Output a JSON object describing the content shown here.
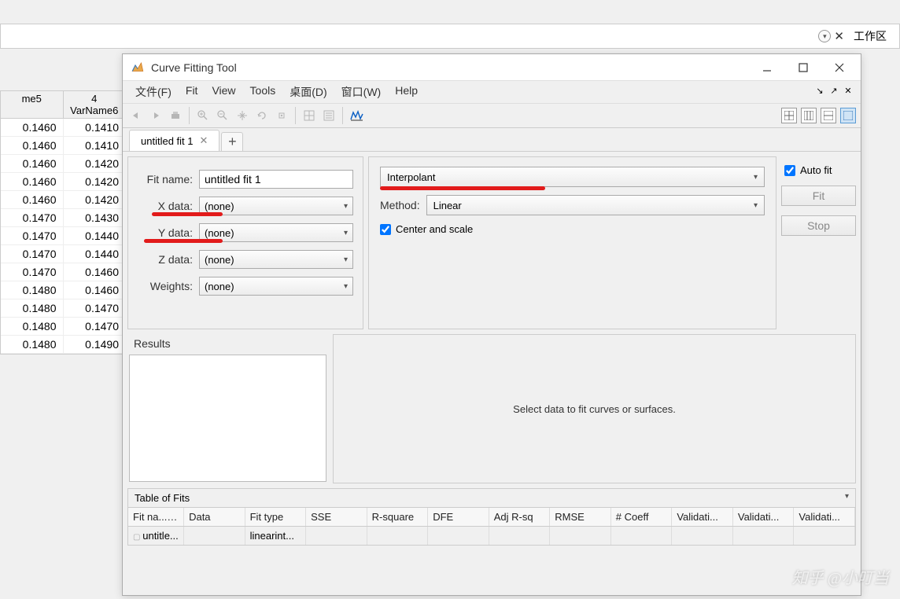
{
  "bg": {
    "workspace_label": "工作区",
    "table_headers": [
      "me5",
      "4\nVarName6"
    ],
    "col1": [
      "0.1460",
      "0.1460",
      "0.1460",
      "0.1460",
      "0.1460",
      "0.1470",
      "0.1470",
      "0.1470",
      "0.1470",
      "0.1480",
      "0.1480",
      "0.1480",
      "0.1480"
    ],
    "col2": [
      "0.1410",
      "0.1410",
      "0.1420",
      "0.1420",
      "0.1420",
      "0.1430",
      "0.1440",
      "0.1440",
      "0.1460",
      "0.1460",
      "0.1470",
      "0.1470",
      "0.1490"
    ],
    "col_num": "4",
    "col_header_a": "me5",
    "col_header_b": "VarName6"
  },
  "window": {
    "title": "Curve Fitting Tool"
  },
  "menu": {
    "file": "文件(F)",
    "fit": "Fit",
    "view": "View",
    "tools": "Tools",
    "desktop": "桌面(D)",
    "window": "窗口(W)",
    "help": "Help"
  },
  "tab": {
    "name": "untitled fit 1"
  },
  "fitcfg": {
    "fitname_label": "Fit name:",
    "fitname_value": "untitled fit 1",
    "xdata_label": "X data:",
    "xdata_value": "(none)",
    "ydata_label": "Y data:",
    "ydata_value": "(none)",
    "zdata_label": "Z data:",
    "zdata_value": "(none)",
    "weights_label": "Weights:",
    "weights_value": "(none)"
  },
  "method": {
    "type": "Interpolant",
    "method_label": "Method:",
    "method_value": "Linear",
    "center_scale_label": "Center and scale"
  },
  "actions": {
    "autofit_label": "Auto fit",
    "fit_label": "Fit",
    "stop_label": "Stop"
  },
  "results": {
    "title": "Results"
  },
  "plot": {
    "placeholder": "Select data to fit curves or surfaces."
  },
  "fits": {
    "title": "Table of Fits",
    "headers": [
      "Fit na... ▲",
      "Data",
      "Fit type",
      "SSE",
      "R-square",
      "DFE",
      "Adj R-sq",
      "RMSE",
      "# Coeff",
      "Validati...",
      "Validati...",
      "Validati..."
    ],
    "row": [
      "untitle...",
      "",
      "linearint...",
      "",
      "",
      "",
      "",
      "",
      "",
      "",
      "",
      ""
    ]
  },
  "watermark": "知乎 @小叮当"
}
